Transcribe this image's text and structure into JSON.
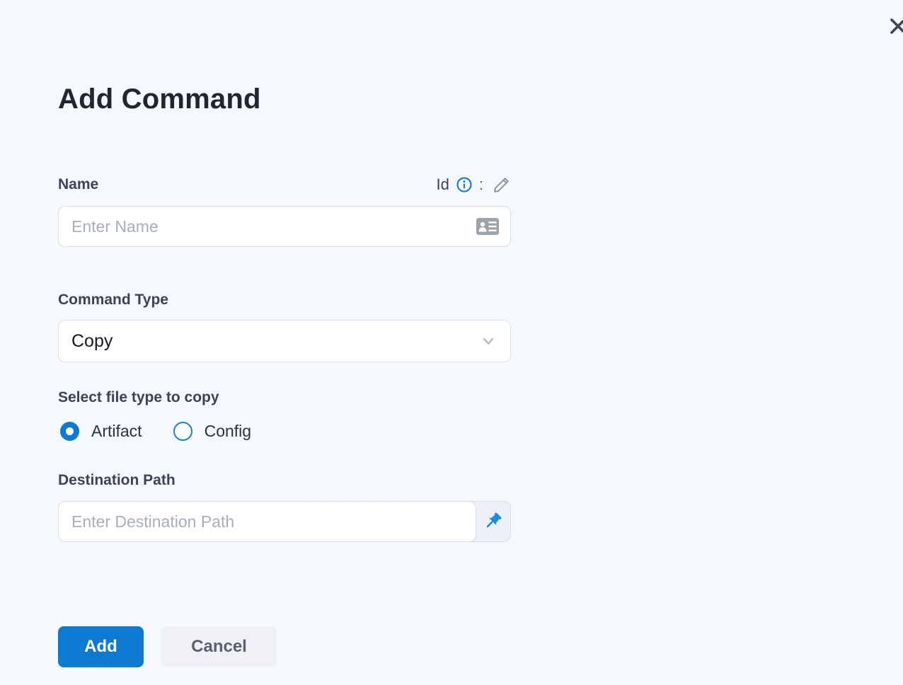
{
  "dialog": {
    "title": "Add Command"
  },
  "form": {
    "name": {
      "label": "Name",
      "id_label": "Id",
      "id_separator": ":",
      "placeholder": "Enter Name",
      "icons": [
        "info-icon",
        "edit-pencil-icon",
        "contact-card-icon"
      ]
    },
    "command_type": {
      "label": "Command Type",
      "value": "Copy",
      "icon": "chevron-down-icon"
    },
    "file_type": {
      "label": "Select file type to copy",
      "options": [
        {
          "label": "Artifact",
          "selected": true
        },
        {
          "label": "Config",
          "selected": false
        }
      ]
    },
    "destination": {
      "label": "Destination Path",
      "placeholder": "Enter Destination Path",
      "icon": "pushpin-icon"
    }
  },
  "footer": {
    "add_label": "Add",
    "cancel_label": "Cancel"
  },
  "colors": {
    "background": "#f5f9fd",
    "accent_blue": "#0d7ad2",
    "pin_blue": "#1b8ce2",
    "info_blue": "#1a7fd4",
    "title_text": "#20262f",
    "label_text": "#3b4354",
    "placeholder_text": "#a7aeba",
    "input_border": "#d9dde4",
    "cancel_bg": "#f0f1f4",
    "cancel_text": "#586071",
    "close_icon": "#3f4456"
  }
}
